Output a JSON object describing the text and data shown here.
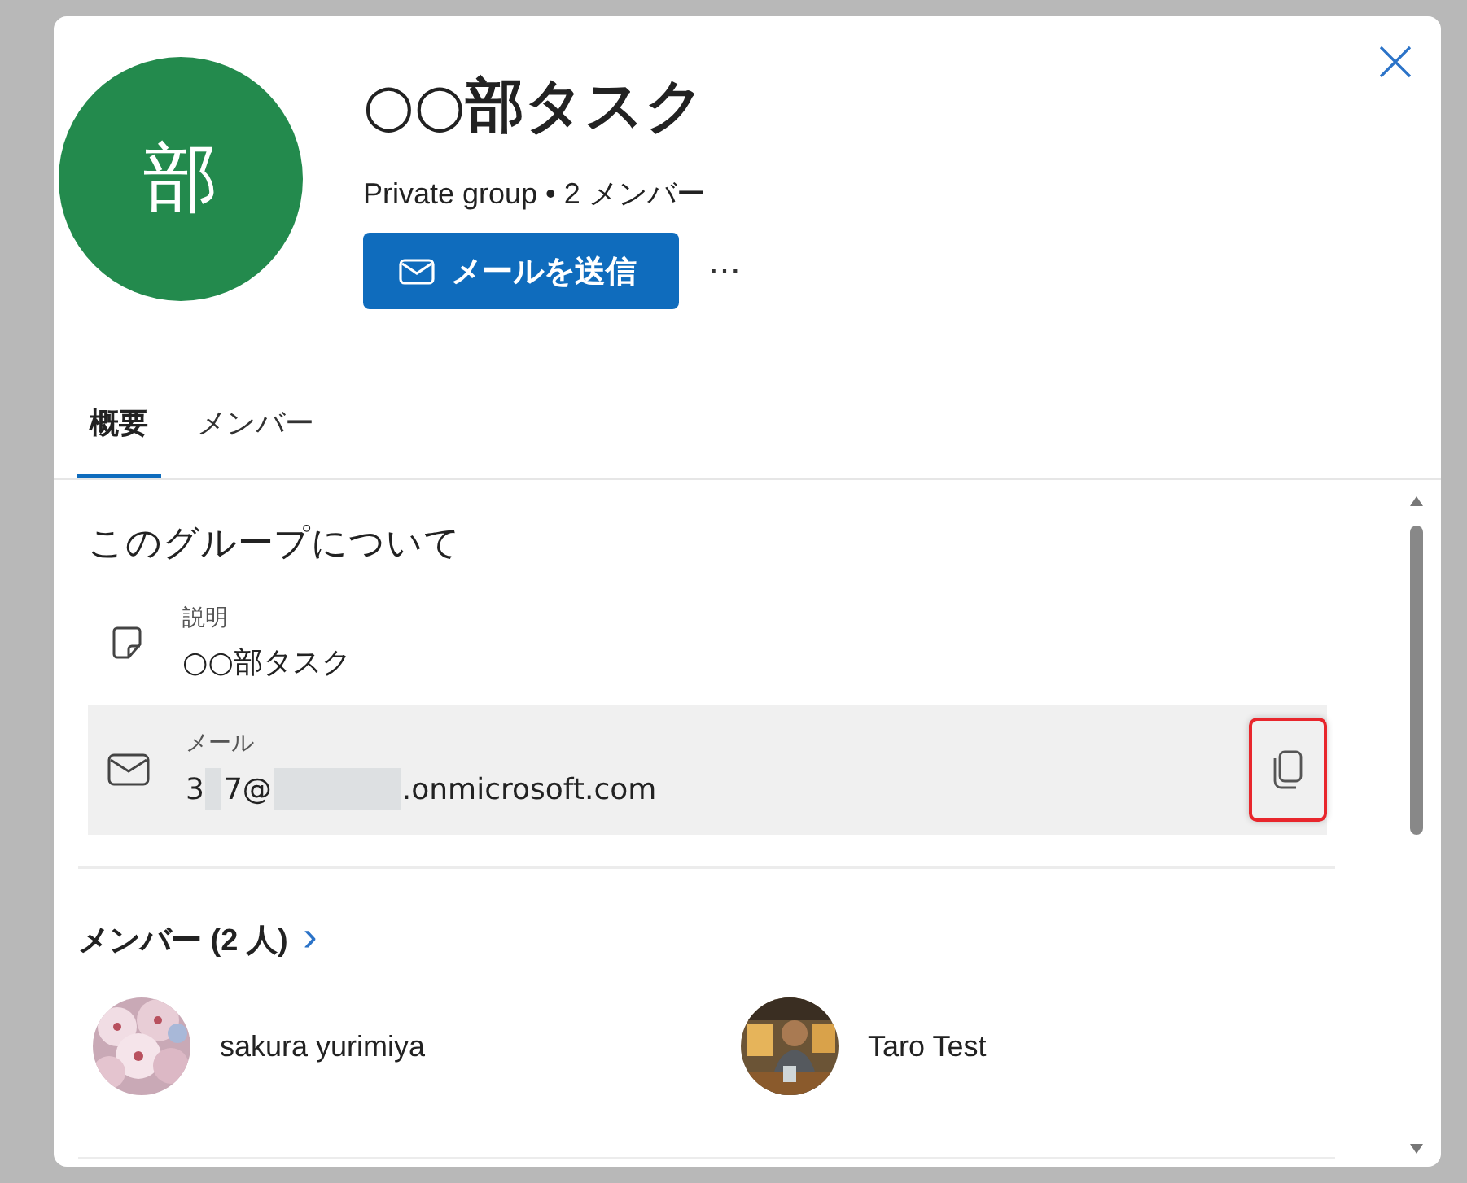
{
  "group": {
    "avatar_letter": "部",
    "name": "○○部タスク",
    "subtitle": "Private group • 2 メンバー"
  },
  "actions": {
    "send_mail": "メールを送信",
    "more": "⋯"
  },
  "tabs": [
    {
      "label": "概要",
      "selected": true
    },
    {
      "label": "メンバー",
      "selected": false
    }
  ],
  "about": {
    "title": "このグループについて",
    "fields": [
      {
        "kind": "description",
        "label": "説明",
        "value": [
          {
            "kind": "text",
            "text": "○○部タスク"
          }
        ],
        "hovered": false
      },
      {
        "kind": "mail",
        "label": "メール",
        "value": [
          {
            "kind": "text",
            "text": "3"
          },
          {
            "kind": "redacted"
          },
          {
            "kind": "text",
            "text": "7@"
          },
          {
            "kind": "redacted"
          },
          {
            "kind": "text",
            "text": ".onmicrosoft.com"
          }
        ],
        "hovered": true,
        "copy_button": {
          "highlighted": true
        }
      }
    ]
  },
  "members": {
    "title": "メンバー (2 人)",
    "chevron": "›",
    "list": [
      {
        "name": "sakura yurimiya",
        "kind": "blossom"
      },
      {
        "name": "Taro Test",
        "kind": "figure"
      }
    ]
  }
}
